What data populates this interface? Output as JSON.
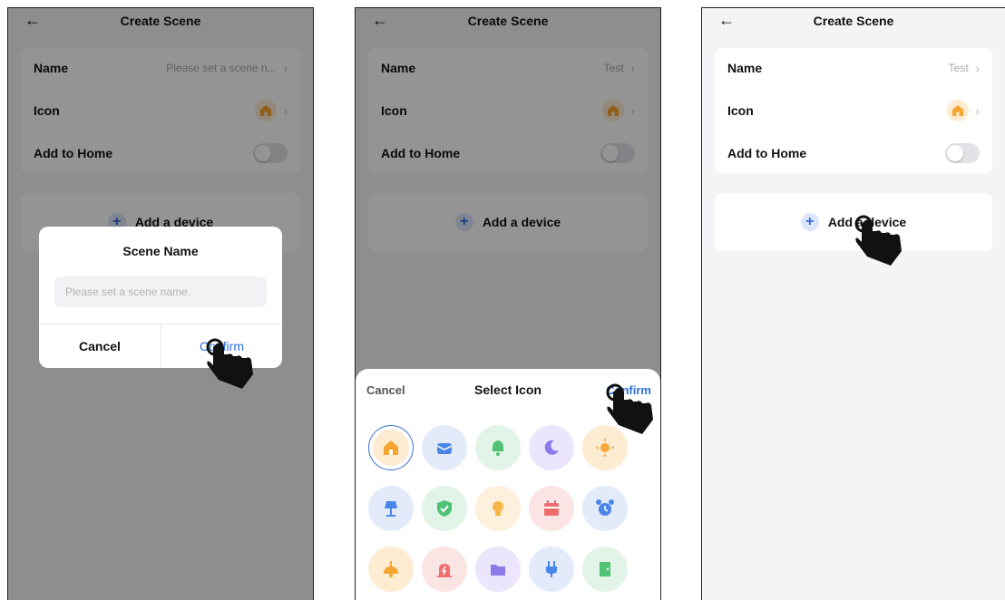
{
  "screens": [
    {
      "header": {
        "title": "Create Scene",
        "back_icon": "arrow-left-icon"
      },
      "settings": {
        "name_label": "Name",
        "name_value": "Please set a scene n...",
        "icon_label": "Icon",
        "home_label": "Add to Home"
      },
      "add_device_label": "Add a device",
      "dialog": {
        "title": "Scene Name",
        "input_placeholder": "Please set a scene name.",
        "cancel_label": "Cancel",
        "confirm_label": "Confirm"
      }
    },
    {
      "header": {
        "title": "Create Scene",
        "back_icon": "arrow-left-icon"
      },
      "settings": {
        "name_label": "Name",
        "name_value": "Test",
        "icon_label": "Icon",
        "home_label": "Add to Home"
      },
      "add_device_label": "Add a device",
      "sheet": {
        "cancel_label": "Cancel",
        "title": "Select Icon",
        "confirm_label": "Confirm",
        "icons": [
          {
            "name": "house-icon",
            "bg": "#fdebd2",
            "color": "#f7a531",
            "selected": true
          },
          {
            "name": "mailbox-icon",
            "bg": "#e3ebfb",
            "color": "#4a86e8"
          },
          {
            "name": "bell-icon",
            "bg": "#e1f4e7",
            "color": "#4fc274"
          },
          {
            "name": "moon-icon",
            "bg": "#ebe6fb",
            "color": "#8c79ea"
          },
          {
            "name": "sun-icon",
            "bg": "#fdebd2",
            "color": "#f8a53c"
          },
          {
            "name": "lamp-icon",
            "bg": "#e3ebfb",
            "color": "#4a86e8"
          },
          {
            "name": "shield-icon",
            "bg": "#e1f4e7",
            "color": "#4fc274"
          },
          {
            "name": "lightbulb-icon",
            "bg": "#fdf0dc",
            "color": "#f7b548"
          },
          {
            "name": "calendar-icon",
            "bg": "#fbe4e4",
            "color": "#ef6f6f"
          },
          {
            "name": "alarm-clock-icon",
            "bg": "#e3ebfb",
            "color": "#4a86e8"
          },
          {
            "name": "ceiling-lamp-icon",
            "bg": "#fdebd2",
            "color": "#f7a531"
          },
          {
            "name": "siren-icon",
            "bg": "#fbe4e4",
            "color": "#ef6f6f"
          },
          {
            "name": "folder-icon",
            "bg": "#ebe6fb",
            "color": "#8c79ea"
          },
          {
            "name": "plug-icon",
            "bg": "#e3ebfb",
            "color": "#4a86e8"
          },
          {
            "name": "door-icon",
            "bg": "#e1f4e7",
            "color": "#4fc274"
          }
        ]
      }
    },
    {
      "header": {
        "title": "Create Scene",
        "back_icon": "arrow-left-icon"
      },
      "settings": {
        "name_label": "Name",
        "name_value": "Test",
        "icon_label": "Icon",
        "home_label": "Add to Home"
      },
      "add_device_label": "Add a device"
    }
  ],
  "colors": {
    "accent": "#2f6ee0",
    "icon_orange": "#f7a531"
  }
}
